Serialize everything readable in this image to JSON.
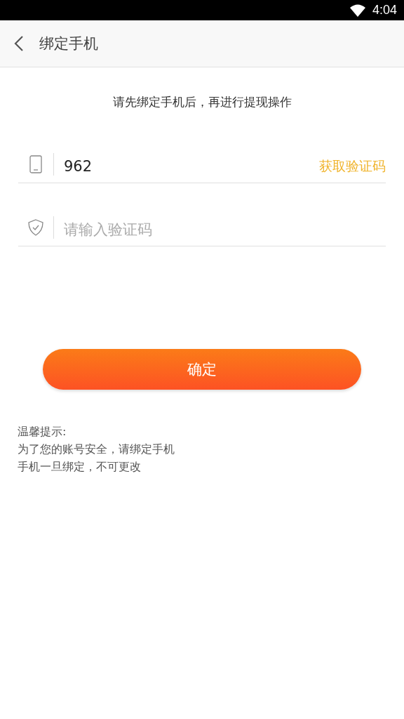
{
  "status_bar": {
    "time": "4:04"
  },
  "header": {
    "title": "绑定手机"
  },
  "intro": "请先绑定手机后，再进行提现操作",
  "phone_field": {
    "value": "962",
    "action": "获取验证码"
  },
  "code_field": {
    "placeholder": "请输入验证码"
  },
  "confirm_button": "确定",
  "tips": [
    "温馨提示:",
    "为了您的账号安全，请绑定手机",
    "手机一旦绑定，不可更改"
  ]
}
